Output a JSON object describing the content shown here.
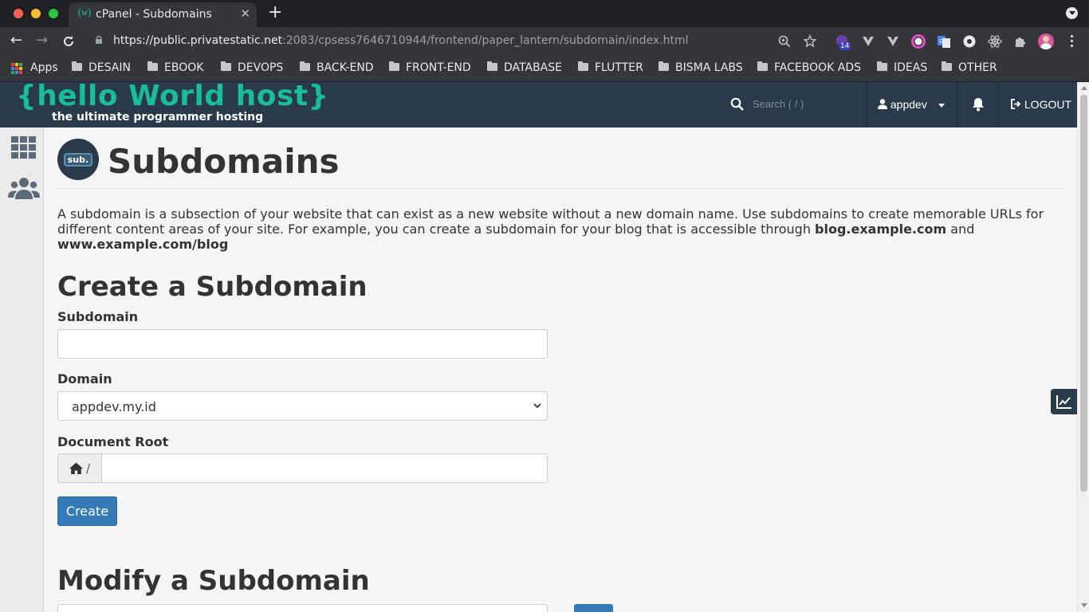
{
  "browser": {
    "tab_title": "cPanel - Subdomains",
    "tab_favicon": "{w}",
    "url_host": "https://public.privatestatic.net",
    "url_rest": ":2083/cpsess7646710944/frontend/paper_lantern/subdomain/index.html",
    "extension_badge": "14",
    "bookmarks": [
      "Apps",
      "DESAIN",
      "EBOOK",
      "DEVOPS",
      "BACK-END",
      "FRONT-END",
      "DATABASE",
      "FLUTTER",
      "BISMA LABS",
      "FACEBOOK ADS",
      "IDEAS",
      "OTHER"
    ]
  },
  "header": {
    "logo_text": "{hello World host}",
    "logo_tagline": "the ultimate programmer hosting",
    "search_placeholder": "Search ( / )",
    "user_label": "appdev",
    "logout_label": "LOGOUT"
  },
  "page": {
    "icon_label": "sub.",
    "title": "Subdomains",
    "description_part1": "A subdomain is a subsection of your website that can exist as a new website without a new domain name. Use subdomains to create memorable URLs for different content areas of your site. For example, you can create a subdomain for your blog that is accessible through ",
    "description_bold1": "blog.example.com",
    "description_and": " and ",
    "description_bold2": "www.example.com/blog"
  },
  "create_form": {
    "heading": "Create a Subdomain",
    "subdomain_label": "Subdomain",
    "subdomain_value": "",
    "domain_label": "Domain",
    "domain_selected": "appdev.my.id",
    "docroot_label": "Document Root",
    "docroot_prefix": "/",
    "docroot_value": "",
    "create_button": "Create"
  },
  "modify": {
    "heading": "Modify a Subdomain"
  },
  "colors": {
    "header_bg": "#293a4a",
    "accent_teal": "#1abc9c",
    "primary_button": "#337ab7"
  }
}
